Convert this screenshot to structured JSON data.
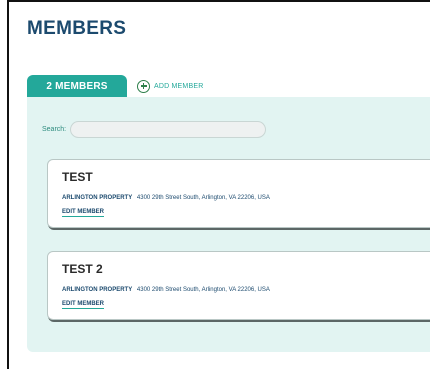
{
  "page": {
    "title": "MEMBERS"
  },
  "tabs": {
    "active_label": "2 MEMBERS",
    "add_member_label": "ADD MEMBER"
  },
  "search": {
    "label": "Search:",
    "value": "",
    "placeholder": ""
  },
  "members": [
    {
      "name": "TEST",
      "property": "ARLINGTON PROPERTY",
      "address": "4300 29th Street South, Arlington, VA 22206, USA",
      "edit_label": "EDIT MEMBER"
    },
    {
      "name": "TEST 2",
      "property": "ARLINGTON PROPERTY",
      "address": "4300 29th Street South, Arlington, VA 22206, USA",
      "edit_label": "EDIT MEMBER"
    }
  ],
  "colors": {
    "title": "#1c4a6e",
    "accent_teal": "#23a89a",
    "panel_background": "#e2f4f2",
    "add_icon": "#2d7f4a"
  },
  "icons": {
    "add_member": "plus-circle-icon"
  }
}
